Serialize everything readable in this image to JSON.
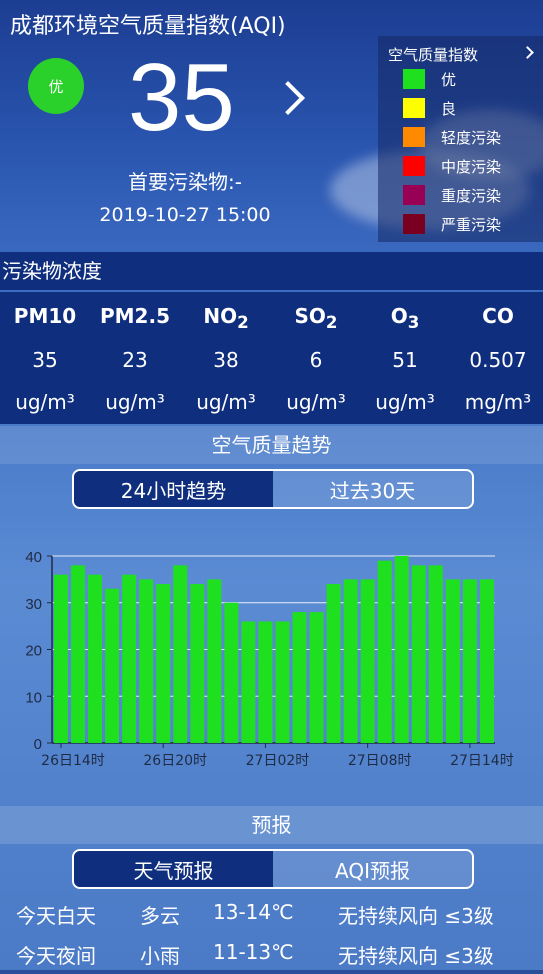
{
  "header": {
    "title": "成都环境空气质量指数(AQI)",
    "level_badge": "优",
    "aqi_value": "35",
    "primary_pollutant": "首要污染物:-",
    "timestamp": "2019-10-27 15:00"
  },
  "legend": {
    "title": "空气质量指数",
    "items": [
      {
        "label": "优",
        "color": "#1ee01e"
      },
      {
        "label": "良",
        "color": "#ffff00"
      },
      {
        "label": "轻度污染",
        "color": "#ff8a00"
      },
      {
        "label": "中度污染",
        "color": "#ff0000"
      },
      {
        "label": "重度污染",
        "color": "#990055"
      },
      {
        "label": "严重污染",
        "color": "#7a0022"
      }
    ]
  },
  "pollutants": {
    "section_title": "污染物浓度",
    "items": [
      {
        "name": "PM10",
        "sub": "",
        "value": "35",
        "unit": "ug/m³"
      },
      {
        "name": "PM2.5",
        "sub": "",
        "value": "23",
        "unit": "ug/m³"
      },
      {
        "name": "NO",
        "sub": "2",
        "value": "38",
        "unit": "ug/m³"
      },
      {
        "name": "SO",
        "sub": "2",
        "value": "6",
        "unit": "ug/m³"
      },
      {
        "name": "O",
        "sub": "3",
        "value": "51",
        "unit": "ug/m³"
      },
      {
        "name": "CO",
        "sub": "",
        "value": "0.507",
        "unit": "mg/m³"
      }
    ]
  },
  "trend": {
    "section_title": "空气质量趋势",
    "tab_24h": "24小时趋势",
    "tab_30d": "过去30天"
  },
  "chart_data": {
    "type": "bar",
    "categories": [
      "26日14时",
      "26日15时",
      "26日16时",
      "26日17时",
      "26日18时",
      "26日19时",
      "26日20时",
      "26日21时",
      "26日22时",
      "26日23时",
      "27日00时",
      "27日01时",
      "27日02时",
      "27日03时",
      "27日04时",
      "27日05时",
      "27日06时",
      "27日07时",
      "27日08时",
      "27日09时",
      "27日10时",
      "27日11时",
      "27日12时",
      "27日13时",
      "27日14时"
    ],
    "values": [
      36,
      38,
      36,
      33,
      36,
      35,
      34,
      38,
      34,
      35,
      30,
      26,
      26,
      26,
      28,
      28,
      34,
      35,
      35,
      39,
      40,
      38,
      38,
      35,
      35,
      35
    ],
    "tick_labels": [
      "26日14时",
      "26日20时",
      "27日02时",
      "27日08时",
      "27日14时"
    ],
    "tick_index": [
      0,
      6,
      12,
      18,
      24
    ],
    "yticks": [
      0,
      10,
      20,
      30,
      40
    ],
    "ylim": [
      0,
      40
    ],
    "bar_color": "#1ee01e",
    "grid": true
  },
  "forecast": {
    "section_title": "预报",
    "tab_weather": "天气预报",
    "tab_aqi": "AQI预报",
    "rows": [
      {
        "period": "今天白天",
        "weather": "多云",
        "temp": "13-14℃",
        "wind": "无持续风向 ≤3级"
      },
      {
        "period": "今天夜间",
        "weather": "小雨",
        "temp": "11-13℃",
        "wind": "无持续风向 ≤3级"
      }
    ]
  }
}
